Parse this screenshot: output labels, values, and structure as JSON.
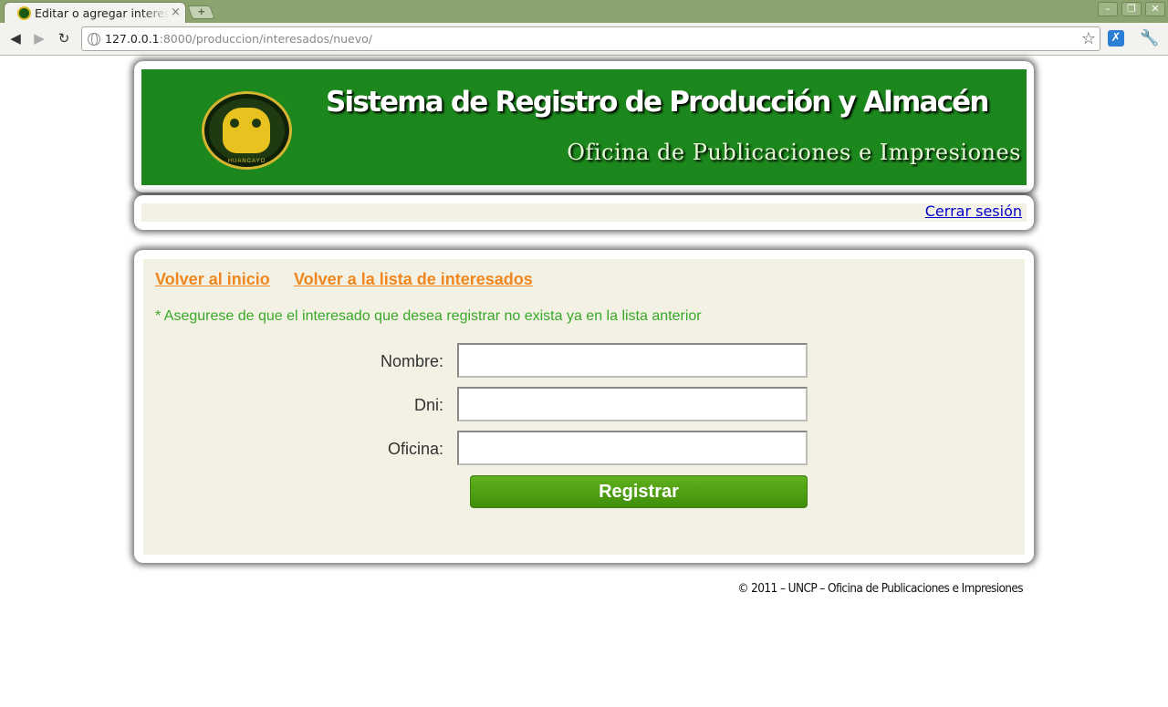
{
  "browser": {
    "tab_title": "Editar o agregar interesados",
    "tab_close": "×",
    "new_tab": "+",
    "window_buttons": {
      "minimize": "–",
      "maximize": "❐",
      "close": "✕"
    },
    "url_host": "127.0.0.1",
    "url_rest": ":8000/produccion/interesados/nuevo/",
    "back": "◀",
    "forward": "▶",
    "reload": "↻",
    "star": "☆",
    "extension": "✗",
    "wrench": "🔧"
  },
  "header": {
    "system_title": "Sistema de Registro de Producción y Almacén",
    "office_title": "Oficina de Publicaciones e Impresiones",
    "logo_text": "HUANCAYO"
  },
  "session": {
    "logout_label": "Cerrar sesión"
  },
  "content": {
    "nav": {
      "home": "Volver al inicio",
      "list": "Volver a la lista de interesados"
    },
    "note": "* Asegurese de que el interesado que desea registrar no exista ya en la lista anterior",
    "form": {
      "fields": [
        {
          "label": "Nombre:",
          "value": ""
        },
        {
          "label": "Dni:",
          "value": ""
        },
        {
          "label": "Oficina:",
          "value": ""
        }
      ],
      "submit_label": "Registrar"
    }
  },
  "footer": {
    "text": "© 2011 – UNCP – Oficina de Publicaciones e Impresiones"
  },
  "colors": {
    "header_green": "#1c871c",
    "link_orange": "#f0861e",
    "note_green": "#38a828",
    "button_green": "#4f9f14",
    "panel_beige": "#f3f1e4"
  }
}
